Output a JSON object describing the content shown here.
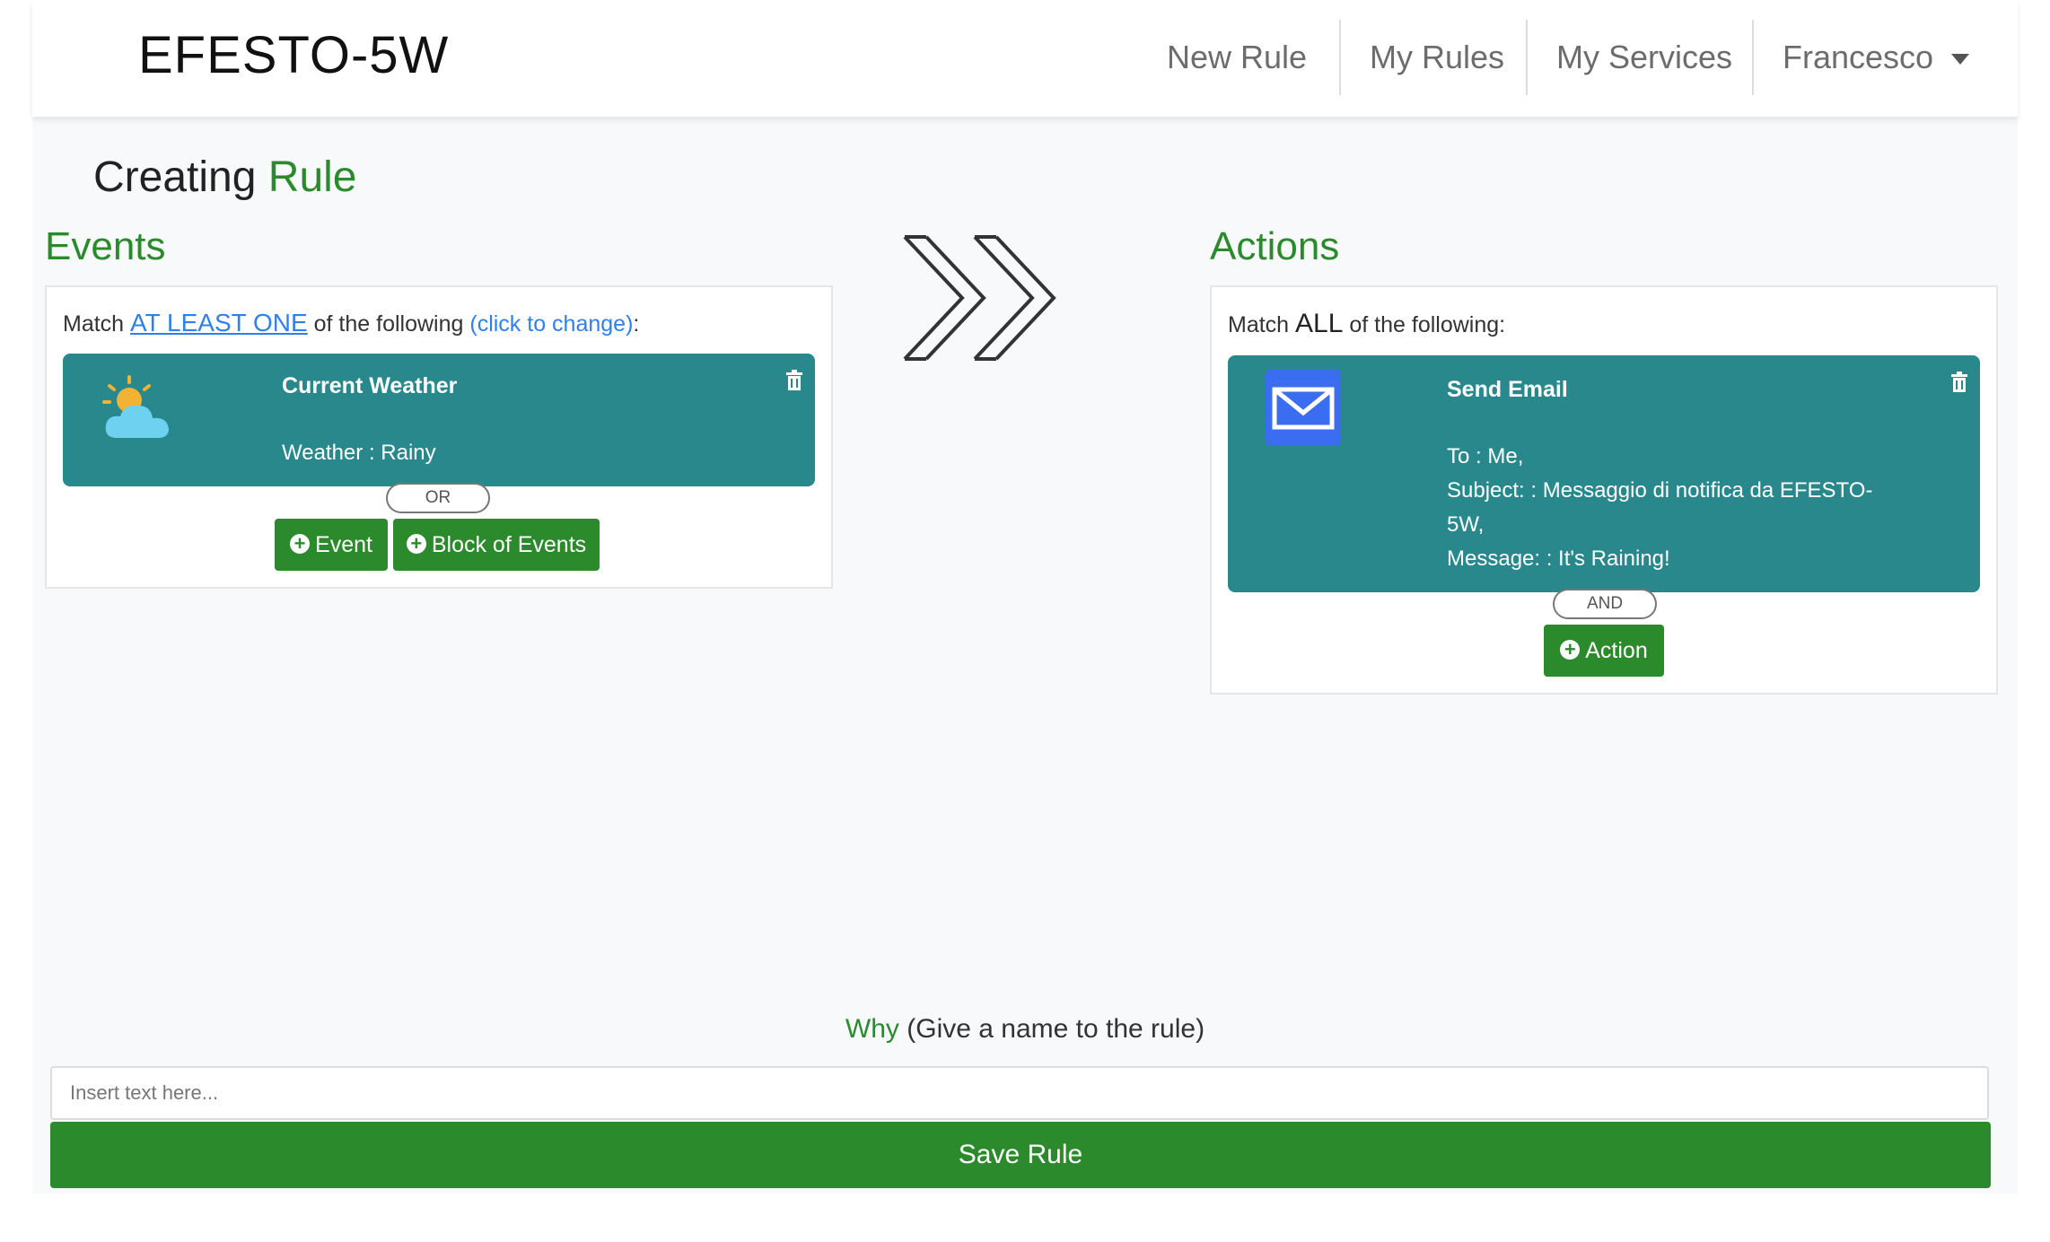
{
  "nav": {
    "brand": "EFESTO-5W",
    "items": [
      "New Rule",
      "My Rules",
      "My Services"
    ],
    "user": "Francesco"
  },
  "page": {
    "title_prefix": "Creating",
    "title_highlight": "Rule"
  },
  "events": {
    "title": "Events",
    "match_prefix": "Match",
    "match_mode": "AT LEAST ONE",
    "match_suffix": "of the following",
    "change_link": "(click to change)",
    "colon": ":",
    "card": {
      "icon": "partly-cloudy-icon",
      "title": "Current Weather",
      "details": [
        "Weather : Rainy"
      ]
    },
    "connector": "OR",
    "add_event_label": "Event",
    "add_block_label": "Block of Events"
  },
  "actions": {
    "title": "Actions",
    "match_prefix": "Match",
    "match_mode": "ALL",
    "match_suffix": "of the following:",
    "card": {
      "icon": "email-icon",
      "title": "Send Email",
      "details": [
        "To : Me,",
        "Subject: : Messaggio di notifica da EFESTO-",
        "5W,",
        "Message: : It's Raining!"
      ]
    },
    "connector": "AND",
    "add_action_label": "Action"
  },
  "why": {
    "label_highlight": "Why",
    "label_rest": "(Give a name to the rule)",
    "placeholder": "Insert text here...",
    "value": ""
  },
  "save_label": "Save Rule",
  "colors": {
    "accent": "#2b8a2b",
    "card": "#28888c",
    "link": "#2f80ed"
  }
}
